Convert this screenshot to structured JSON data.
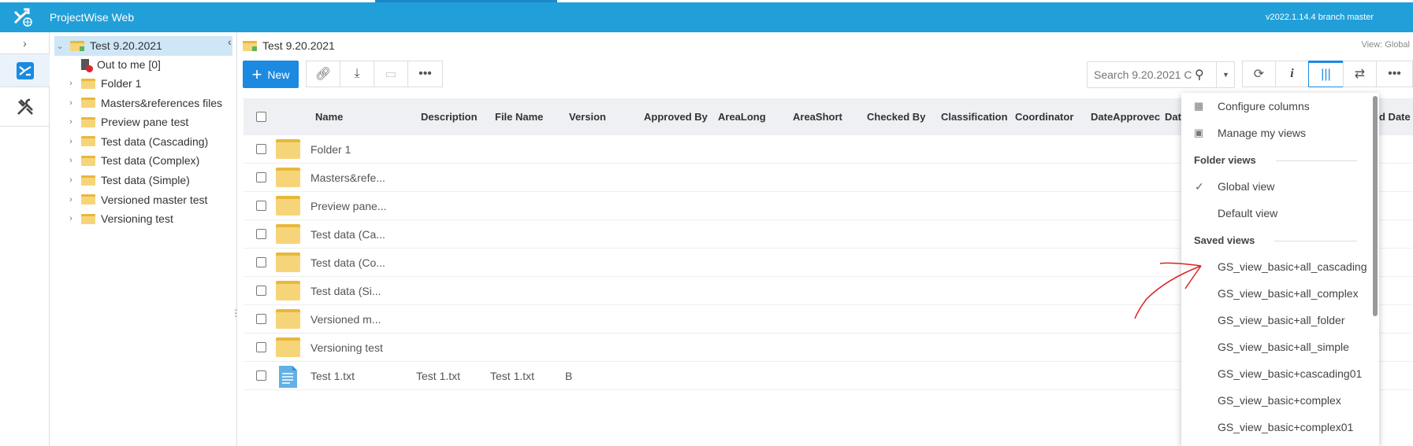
{
  "header": {
    "app_title": "ProjectWise Web",
    "version": "v2022.1.14.4 branch master"
  },
  "tree": {
    "root": "Test 9.20.2021",
    "out_to_me": "Out to me [0]",
    "items": [
      "Folder 1",
      "Masters&references files",
      "Preview pane test",
      "Test data (Cascading)",
      "Test data (Complex)",
      "Test data (Simple)",
      "Versioned master test",
      "Versioning test"
    ]
  },
  "breadcrumb": "Test 9.20.2021",
  "view_label": "View: Global",
  "toolbar": {
    "new_label": "New"
  },
  "search": {
    "placeholder": "Search 9.20.2021 C"
  },
  "table": {
    "columns": [
      "Name",
      "Description",
      "File Name",
      "Version",
      "Approved By",
      "AreaLong",
      "AreaShort",
      "Checked By",
      "Classification",
      "Coordinator",
      "DateApprovec",
      "Dat",
      "d Date"
    ],
    "rows": [
      {
        "name": "Folder 1",
        "type": "folder"
      },
      {
        "name": "Masters&refe...",
        "type": "folder"
      },
      {
        "name": "Preview pane...",
        "type": "folder"
      },
      {
        "name": "Test data (Ca...",
        "type": "folder"
      },
      {
        "name": "Test data (Co...",
        "type": "folder"
      },
      {
        "name": "Test data (Si...",
        "type": "folder"
      },
      {
        "name": "Versioned m...",
        "type": "folder"
      },
      {
        "name": "Versioning test",
        "type": "folder"
      },
      {
        "name": "Test 1.txt",
        "type": "file",
        "description": "Test 1.txt",
        "file_name": "Test 1.txt",
        "version": "B"
      }
    ]
  },
  "menu": {
    "configure": "Configure columns",
    "manage": "Manage my views",
    "folder_views_heading": "Folder views",
    "global_view": "Global view",
    "default_view": "Default view",
    "saved_views_heading": "Saved views",
    "saved_views": [
      "GS_view_basic+all_cascading",
      "GS_view_basic+all_complex",
      "GS_view_basic+all_folder",
      "GS_view_basic+all_simple",
      "GS_view_basic+cascading01",
      "GS_view_basic+complex",
      "GS_view_basic+complex01"
    ]
  },
  "colors": {
    "header": "#219fd8",
    "primary": "#1b8ae0",
    "folder": "#f6d57a",
    "annotation": "#e02020"
  }
}
